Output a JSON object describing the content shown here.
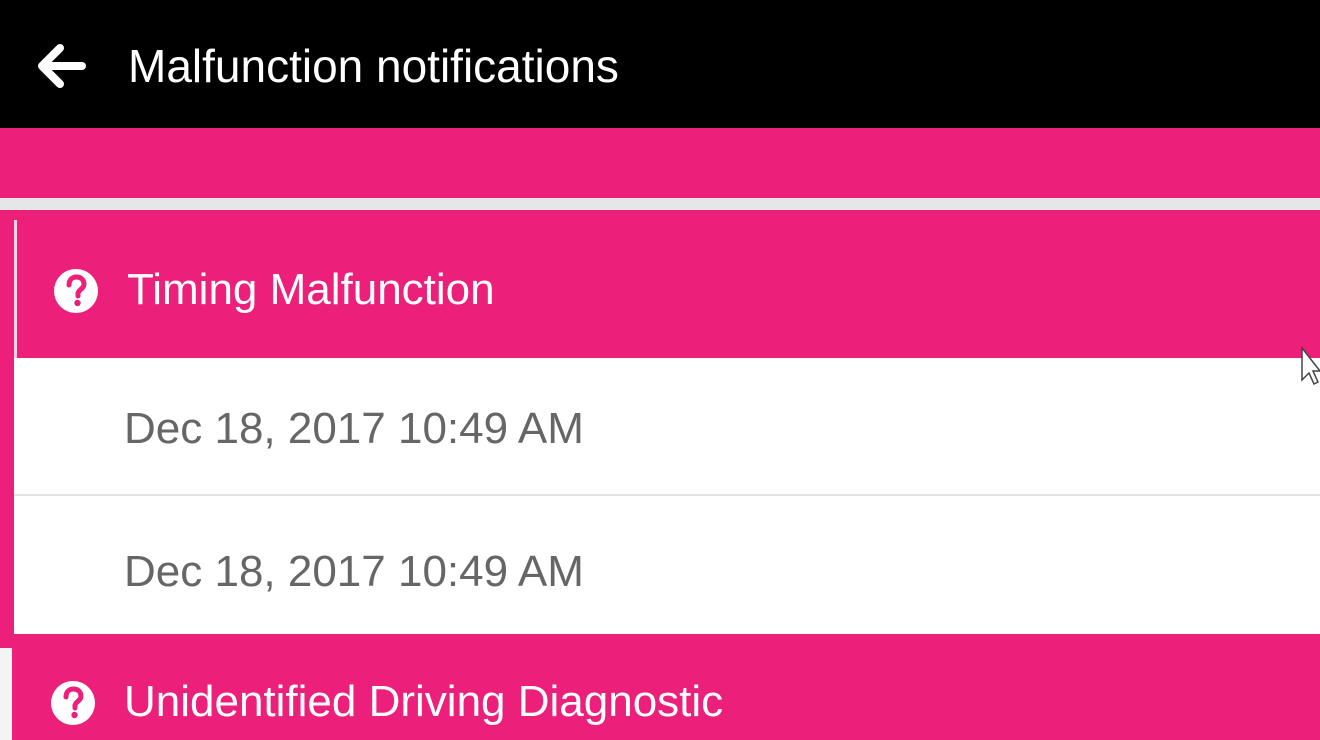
{
  "app_bar": {
    "title": "Malfunction notifications",
    "back_icon": "arrow-left-icon",
    "background": "#000000",
    "text_color": "#ffffff"
  },
  "theme": {
    "accent": "#ec1f7a",
    "divider": "#e6e6e6",
    "entry_text_color": "#666666"
  },
  "groups": [
    {
      "title": "Timing Malfunction",
      "icon": "help-circle-icon",
      "entries": [
        {
          "timestamp": "Dec 18, 2017 10:49 AM"
        },
        {
          "timestamp": "Dec 18, 2017 10:49 AM"
        }
      ]
    },
    {
      "title": "Unidentified Driving Diagnostic",
      "icon": "help-circle-icon",
      "entries": []
    }
  ]
}
